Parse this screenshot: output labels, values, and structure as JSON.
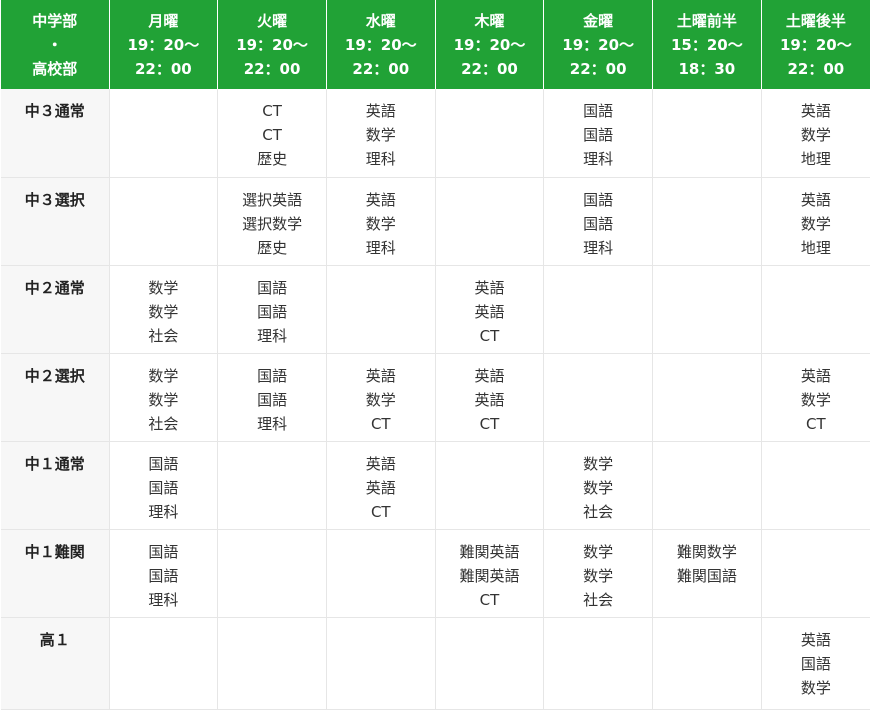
{
  "header": {
    "corner": [
      "中学部",
      "・",
      "高校部"
    ],
    "days": [
      {
        "name": "月曜",
        "start": "19：20〜",
        "end": "22：00"
      },
      {
        "name": "火曜",
        "start": "19：20〜",
        "end": "22：00"
      },
      {
        "name": "水曜",
        "start": "19：20〜",
        "end": "22：00"
      },
      {
        "name": "木曜",
        "start": "19：20〜",
        "end": "22：00"
      },
      {
        "name": "金曜",
        "start": "19：20〜",
        "end": "22：00"
      },
      {
        "name": "土曜前半",
        "start": "15：20〜",
        "end": "18：30"
      },
      {
        "name": "土曜後半",
        "start": "19：20〜",
        "end": "22：00"
      }
    ]
  },
  "rows": [
    {
      "label": "中３通常",
      "cells": [
        [],
        [
          "CT",
          "CT",
          "歴史"
        ],
        [
          "英語",
          "数学",
          "理科"
        ],
        [],
        [
          "国語",
          "国語",
          "理科"
        ],
        [],
        [
          "英語",
          "数学",
          "地理"
        ]
      ]
    },
    {
      "label": "中３選択",
      "cells": [
        [],
        [
          "選択英語",
          "選択数学",
          "歴史"
        ],
        [
          "英語",
          "数学",
          "理科"
        ],
        [],
        [
          "国語",
          "国語",
          "理科"
        ],
        [],
        [
          "英語",
          "数学",
          "地理"
        ]
      ]
    },
    {
      "label": "中２通常",
      "cells": [
        [
          "数学",
          "数学",
          "社会"
        ],
        [
          "国語",
          "国語",
          "理科"
        ],
        [],
        [
          "英語",
          "英語",
          "CT"
        ],
        [],
        [],
        []
      ]
    },
    {
      "label": "中２選択",
      "cells": [
        [
          "数学",
          "数学",
          "社会"
        ],
        [
          "国語",
          "国語",
          "理科"
        ],
        [
          "英語",
          "数学",
          "CT"
        ],
        [
          "英語",
          "英語",
          "CT"
        ],
        [],
        [],
        [
          "英語",
          "数学",
          "CT"
        ]
      ]
    },
    {
      "label": "中１通常",
      "cells": [
        [
          "国語",
          "国語",
          "理科"
        ],
        [],
        [
          "英語",
          "英語",
          "CT"
        ],
        [],
        [
          "数学",
          "数学",
          "社会"
        ],
        [],
        []
      ]
    },
    {
      "label": "中１難関",
      "cells": [
        [
          "国語",
          "国語",
          "理科"
        ],
        [],
        [],
        [
          "難関英語",
          "難関英語",
          "CT"
        ],
        [
          "数学",
          "数学",
          "社会"
        ],
        [
          "難関数学",
          "難関国語"
        ],
        []
      ]
    },
    {
      "label": "高１",
      "cells": [
        [],
        [],
        [],
        [],
        [],
        [],
        [
          "英語",
          "国語",
          "数学"
        ]
      ]
    }
  ]
}
